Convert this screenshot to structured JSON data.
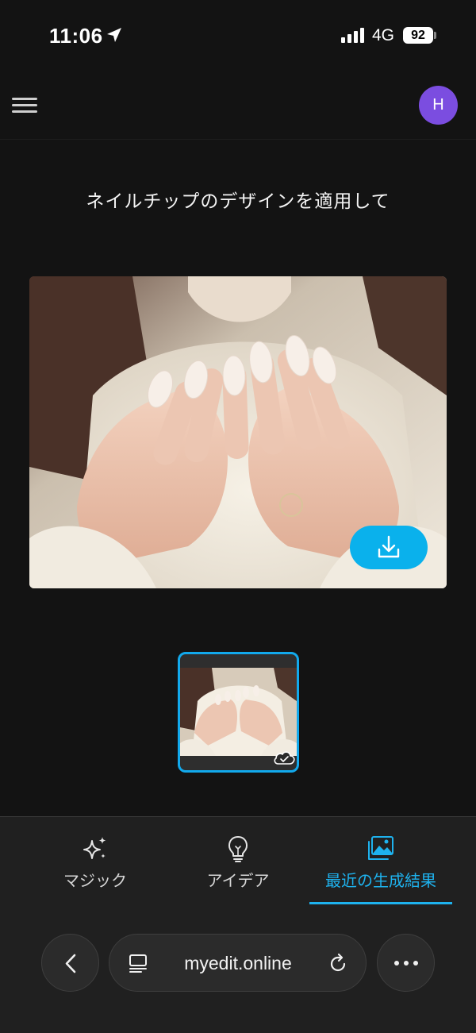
{
  "status_bar": {
    "time": "11:06",
    "network": "4G",
    "battery": "92",
    "icons": [
      "location-arrow-icon",
      "signal-bars-icon",
      "battery-icon"
    ]
  },
  "header": {
    "menu_icon": "hamburger-menu-icon",
    "avatar_initial": "H",
    "avatar_color": "#7b4de0"
  },
  "page": {
    "title": "ネイルチップのデザインを適用して"
  },
  "main_image": {
    "subject": "hands with pearl-white almond nails",
    "download_icon": "download-icon",
    "accent_color": "#0ab1ec"
  },
  "thumbnails": [
    {
      "selected": true,
      "status_icon": "cloud-check-icon"
    }
  ],
  "tabs": [
    {
      "label": "マジック",
      "icon": "sparkles-icon",
      "active": false
    },
    {
      "label": "アイデア",
      "icon": "lightbulb-icon",
      "active": false
    },
    {
      "label": "最近の生成結果",
      "icon": "images-icon",
      "active": true
    }
  ],
  "browser": {
    "url": "myedit.online",
    "icons": [
      "back-chevron-icon",
      "reader-icon",
      "reload-icon",
      "more-dots-icon"
    ]
  },
  "colors": {
    "background": "#131313",
    "accent": "#1eb2ee",
    "tab_bar": "#202020"
  }
}
